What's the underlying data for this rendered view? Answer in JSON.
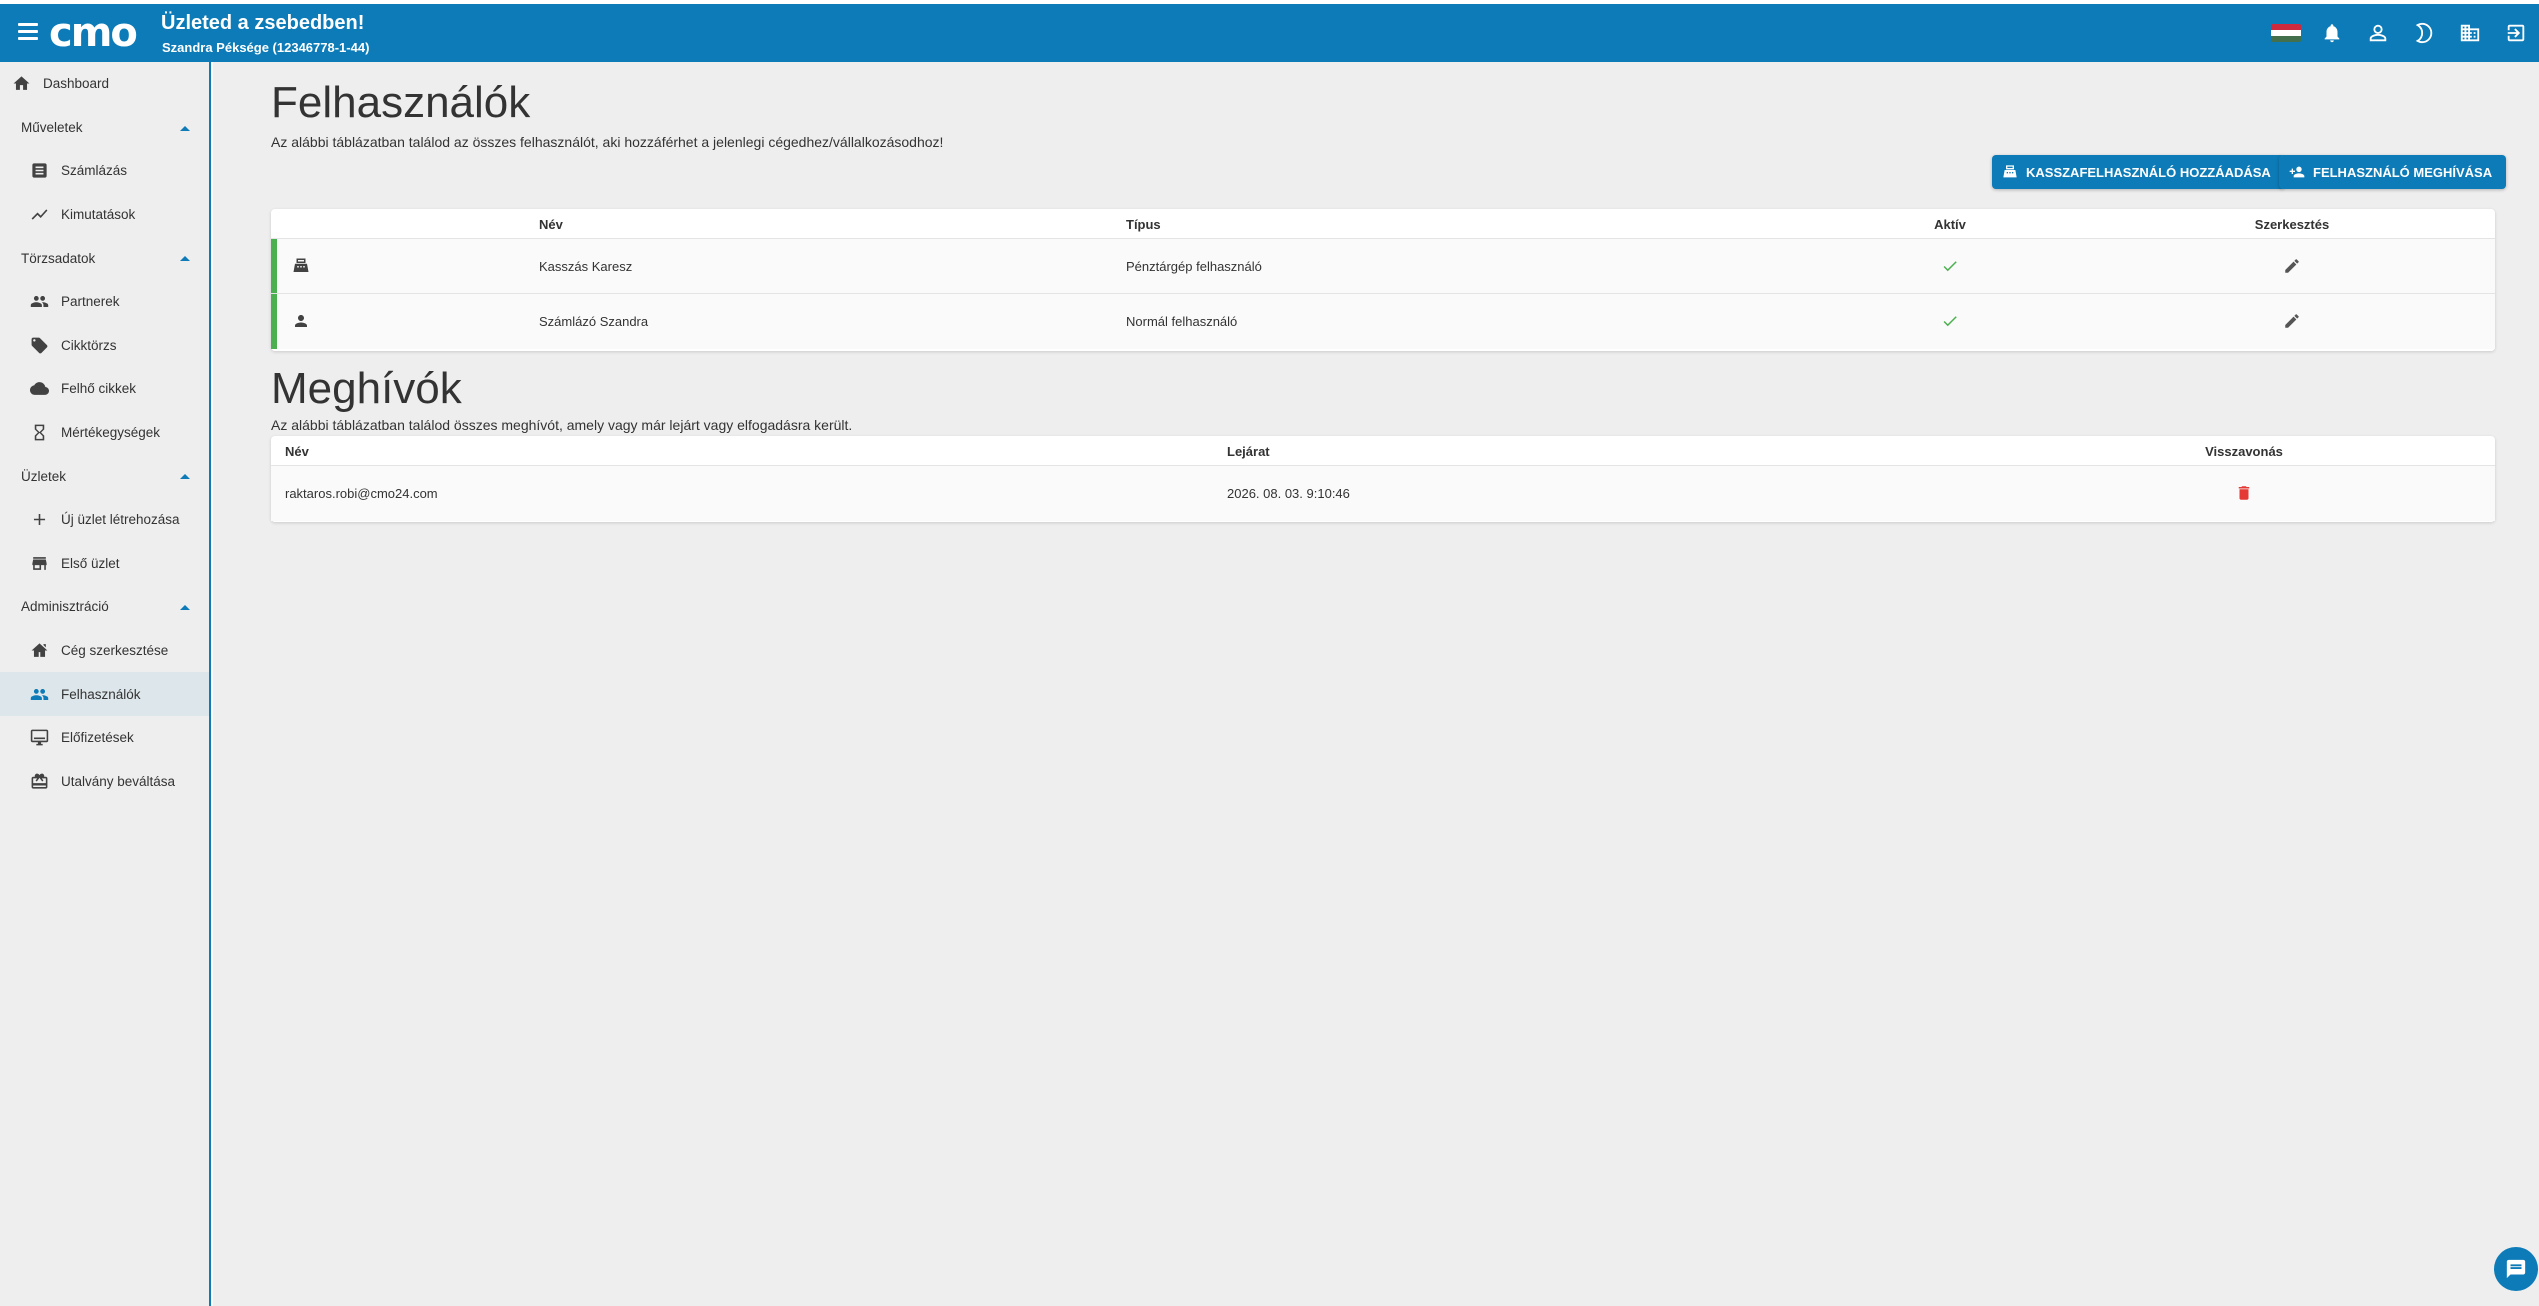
{
  "header": {
    "logo": "cmo",
    "title": "Üzleted a zsebedben!",
    "subtitle": "Szandra Péksége (12346778-1-44)",
    "flag_colors": [
      "#cd2a3e",
      "#ffffff",
      "#436f4d"
    ],
    "icons": [
      "flag-hu-icon",
      "bell-icon",
      "account-icon",
      "moon-icon",
      "company-icon",
      "logout-icon"
    ]
  },
  "sidebar": {
    "dashboard": "Dashboard",
    "sections": [
      {
        "label": "Műveletek",
        "items": [
          "Számlázás",
          "Kimutatások"
        ]
      },
      {
        "label": "Törzsadatok",
        "items": [
          "Partnerek",
          "Cikktörzs",
          "Felhő cikkek",
          "Mértékegységek"
        ]
      },
      {
        "label": "Üzletek",
        "items": [
          "Új üzlet létrehozása",
          "Első üzlet"
        ]
      },
      {
        "label": "Adminisztráció",
        "items": [
          "Cég szerkesztése",
          "Felhasználók",
          "Előfizetések",
          "Utalvány beváltása"
        ]
      }
    ],
    "active": "Felhasználók"
  },
  "users": {
    "title": "Felhasználók",
    "description": "Az alábbi táblázatban találod az összes felhasználót, aki hozzáférhet a jelenlegi cégedhez/vállalkozásodhoz!",
    "add_cashier_button": "KASSZAFELHASZNÁLÓ HOZZÁADÁSA",
    "invite_button": "FELHASZNÁLÓ MEGHÍVÁSA",
    "columns": [
      "Név",
      "Típus",
      "Aktív",
      "Szerkesztés"
    ],
    "rows": [
      {
        "icon": "cash-register-icon",
        "name": "Kasszás Karesz",
        "type": "Pénztárgép felhasználó",
        "active": true
      },
      {
        "icon": "person-icon",
        "name": "Számlázó Szandra",
        "type": "Normál felhasználó",
        "active": true
      }
    ]
  },
  "invites": {
    "title": "Meghívók",
    "description": "Az alábbi táblázatban találod összes meghívót, amely vagy már lejárt vagy elfogadásra került.",
    "columns": [
      "Név",
      "Lejárat",
      "Visszavonás"
    ],
    "rows": [
      {
        "email": "raktaros.robi@cmo24.com",
        "expiry": "2026. 08. 03. 9:10:46"
      }
    ]
  },
  "colors": {
    "primary": "#0c7bb7",
    "success": "#4caf50",
    "danger": "#e53935"
  }
}
